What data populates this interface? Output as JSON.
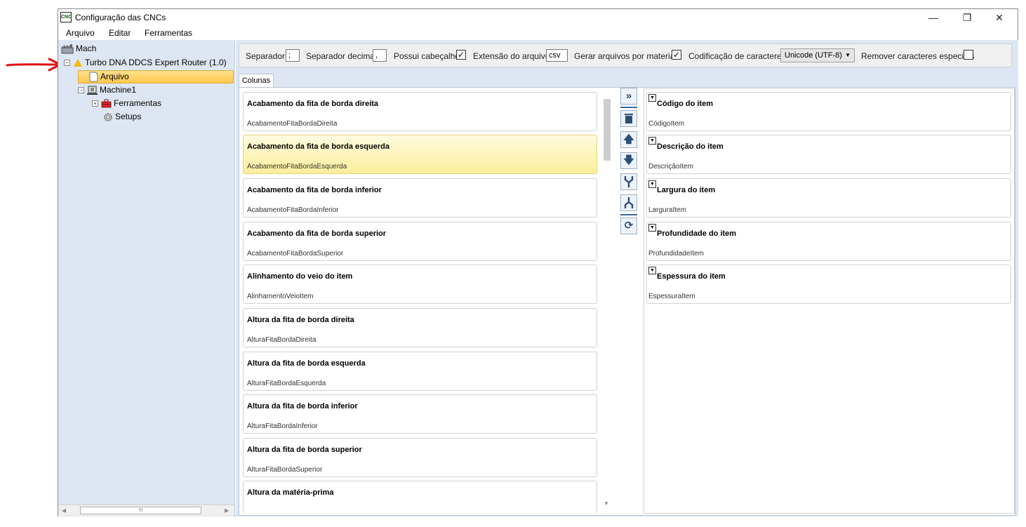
{
  "window": {
    "title": "Configuração das CNCs",
    "app_icon": "CNC",
    "controls": {
      "minimize": "—",
      "maximize": "❐",
      "close": "✕"
    }
  },
  "menu": [
    "Arquivo",
    "Editar",
    "Ferramentas"
  ],
  "tree": {
    "root": "Mach",
    "machine_config": "Turbo DNA DDCS Expert Router (1.0)",
    "arquivo": "Arquivo",
    "machine": "Machine1",
    "ferramentas": "Ferramentas",
    "setups": "Setups",
    "scroll_grip": "III"
  },
  "toolbar": {
    "separador_label": "Separador",
    "separador_value": ";",
    "decimal_label": "Separador decimal",
    "decimal_value": ",",
    "cabecalho_label": "Possui cabeçalho",
    "cabecalho_checked": true,
    "extensao_label": "Extensão do arquivo",
    "extensao_value": "csv",
    "gerar_label": "Gerar arquivos por material",
    "gerar_checked": true,
    "codificacao_label": "Codificação de caracteres",
    "codificacao_value": "Unicode (UTF-8)",
    "remover_label": "Remover caracteres especiais",
    "remover_checked": false
  },
  "tab_label": "Colunas",
  "available_columns": [
    {
      "title": "Acabamento da fita de borda direita",
      "field": "AcabamentoFitaBordaDireita",
      "highlighted": false
    },
    {
      "title": "Acabamento da fita de borda esquerda",
      "field": "AcabamentoFitaBordaEsquerda",
      "highlighted": true
    },
    {
      "title": "Acabamento da fita de borda inferior",
      "field": "AcabamentoFitaBordaInferior",
      "highlighted": false
    },
    {
      "title": "Acabamento da fita de borda superior",
      "field": "AcabamentoFitaBordaSuperior",
      "highlighted": false
    },
    {
      "title": "Alinhamento do veio do item",
      "field": "AlinhamentoVeioItem",
      "highlighted": false
    },
    {
      "title": "Altura da fita de borda direita",
      "field": "AlturaFitaBordaDireita",
      "highlighted": false
    },
    {
      "title": "Altura da fita de borda esquerda",
      "field": "AlturaFitaBordaEsquerda",
      "highlighted": false
    },
    {
      "title": "Altura da fita de borda inferior",
      "field": "AlturaFitaBordaInferior",
      "highlighted": false
    },
    {
      "title": "Altura da fita de borda superior",
      "field": "AlturaFitaBordaSuperior",
      "highlighted": false
    },
    {
      "title": "Altura da matéria-prima",
      "field": "",
      "highlighted": false
    }
  ],
  "selected_columns": [
    {
      "title": "Código do item",
      "field": "CódigoItem"
    },
    {
      "title": "Descrição do item",
      "field": "DescriçãoItem"
    },
    {
      "title": "Largura do item",
      "field": "LarguraItem"
    },
    {
      "title": "Profundidade do item",
      "field": "ProfundidadeItem"
    },
    {
      "title": "Espessura do item",
      "field": "EspessuraItem"
    }
  ],
  "action_icons": [
    "add-all-icon",
    "delete-icon",
    "move-up-icon",
    "move-down-icon",
    "merge-icon",
    "split-icon",
    "refresh-icon"
  ],
  "colors": {
    "sidebar_bg": "#dde7f3",
    "selection": "#ffc94d",
    "highlight": "#fcef9c",
    "accent": "#2c4f78",
    "annotation_arrow": "#e01010"
  }
}
